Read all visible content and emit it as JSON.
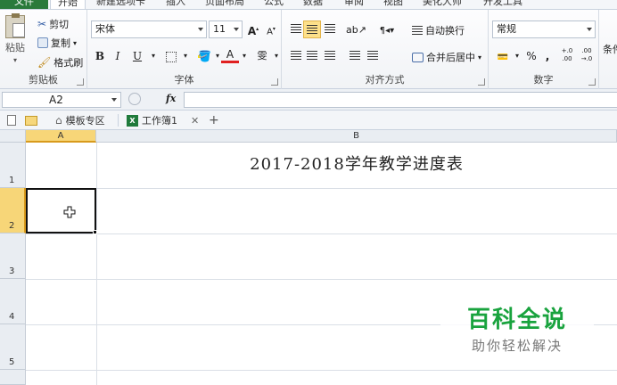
{
  "ribbon_tabs": [
    "文件",
    "开始",
    "新建选项卡",
    "插入",
    "页面布局",
    "公式",
    "数据",
    "审阅",
    "视图",
    "美化大师",
    "开发工具"
  ],
  "clipboard": {
    "paste": "粘贴",
    "cut": "剪切",
    "copy": "复制",
    "format_painter": "格式刷",
    "label": "剪贴板"
  },
  "font": {
    "name": "宋体",
    "size": "11",
    "grow": "A",
    "shrink": "A",
    "bold": "B",
    "italic": "I",
    "underline": "U",
    "font_color": "A",
    "phonetic": "雯",
    "label": "字体"
  },
  "alignment": {
    "wrap_text": "自动换行",
    "merge_center": "合并后居中",
    "label": "对齐方式"
  },
  "number": {
    "format": "常规",
    "percent": "%",
    "comma": ",",
    "inc_decimal": ".00→.0",
    "dec_decimal": ".00",
    "label": "数字"
  },
  "styles_partial": "条件",
  "formula_bar": {
    "cell_ref": "A2",
    "fx": "fx",
    "content": ""
  },
  "doc_tabs": {
    "templates": "模板专区",
    "workbook": "工作簿1",
    "add": "+"
  },
  "sheet": {
    "columns": [
      "A",
      "B"
    ],
    "rows": [
      "1",
      "2",
      "3",
      "4",
      "5"
    ],
    "title": "2017-2018学年教学进度表",
    "active_cell": "A2"
  },
  "watermark": {
    "title": "百科全说",
    "subtitle": "助你轻松解决"
  },
  "colors": {
    "file_tab": "#2a7a3b",
    "selection_header": "#f7d678",
    "watermark_green": "#19a33e",
    "active_toggle": "#fde08a"
  }
}
